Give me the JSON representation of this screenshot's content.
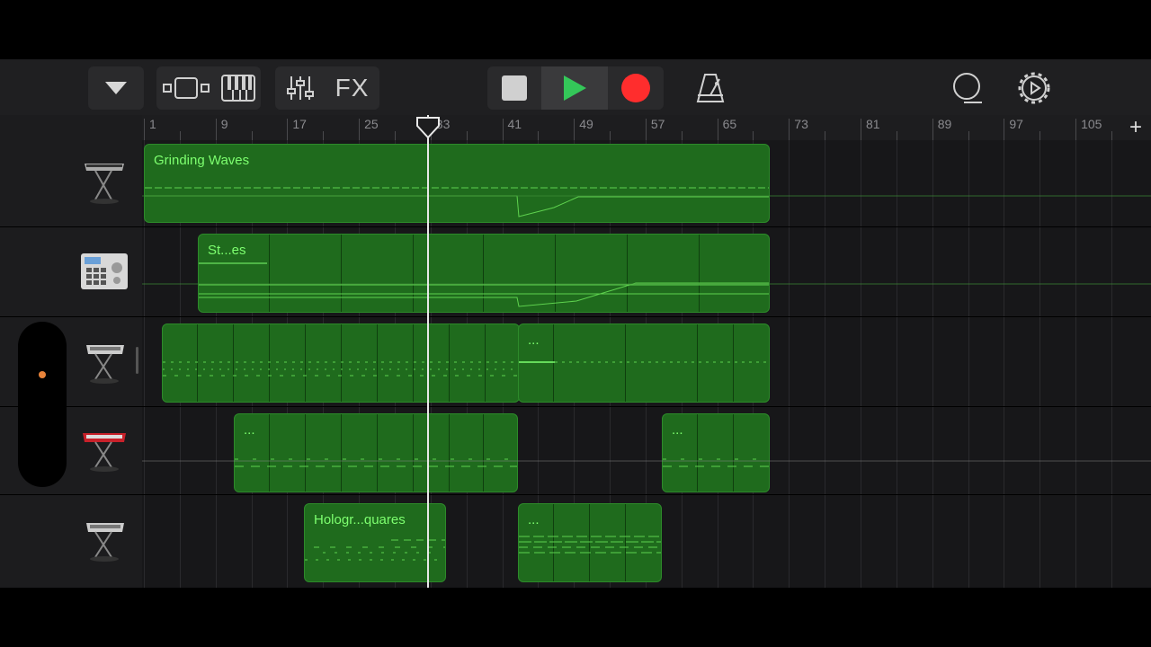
{
  "toolbar": {
    "fx_label": "FX",
    "icons": [
      "view-dropdown-icon",
      "tracks-view-icon",
      "keyboard-icon",
      "mixer-icon",
      "fx-icon",
      "stop-icon",
      "play-icon",
      "record-icon",
      "metronome-icon",
      "loop-icon",
      "settings-icon"
    ],
    "colors": {
      "play": "#34c759",
      "record": "#ff2d2d",
      "stop": "#d0d0d0"
    }
  },
  "ruler": {
    "labels": [
      "1",
      "9",
      "17",
      "25",
      "33",
      "41",
      "49",
      "57",
      "65",
      "73",
      "81",
      "89",
      "97",
      "105"
    ],
    "add_label": "+"
  },
  "tracks": [
    {
      "instrument": "synth-keyboard-icon",
      "regions": [
        {
          "label": "Grinding Waves"
        }
      ]
    },
    {
      "instrument": "drum-machine-icon",
      "regions": [
        {
          "label": "St...es"
        }
      ]
    },
    {
      "instrument": "keyboard-stand-icon",
      "regions": [
        {
          "label": ""
        },
        {
          "label": "..."
        }
      ]
    },
    {
      "instrument": "red-keyboard-icon",
      "regions": [
        {
          "label": "..."
        },
        {
          "label": "..."
        }
      ]
    },
    {
      "instrument": "keyboard-stand-icon",
      "regions": [
        {
          "label": "Hologr...quares"
        },
        {
          "label": "..."
        }
      ]
    }
  ],
  "colors": {
    "region_fill": "#1f6b1d",
    "region_text": "#7dff6f",
    "slider_dot": "#e8833a"
  }
}
